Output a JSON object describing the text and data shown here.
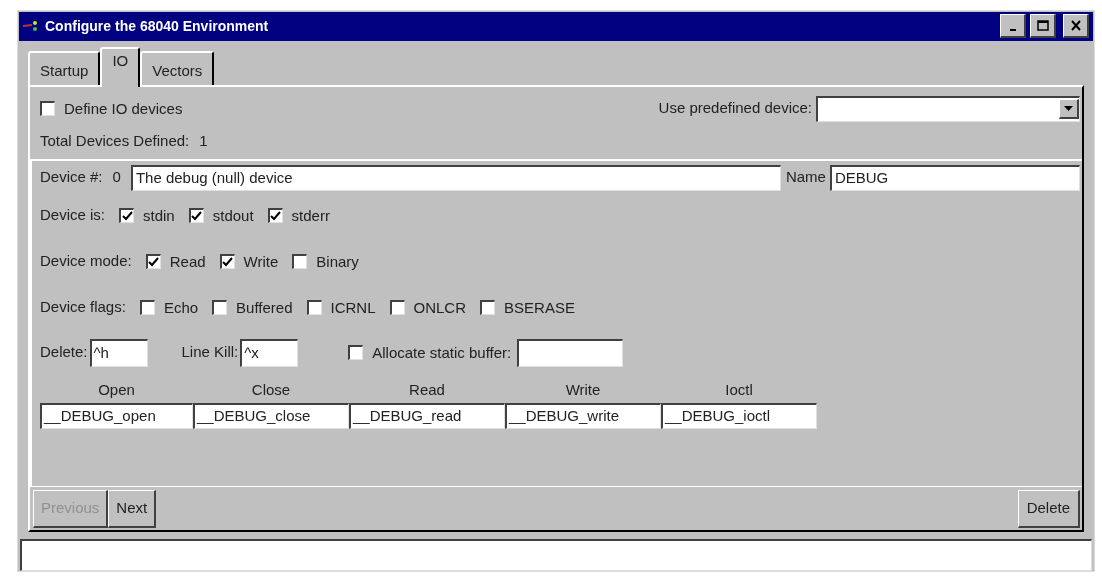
{
  "window": {
    "title": "Configure the 68040 Environment"
  },
  "tabs": [
    {
      "label": "Startup",
      "selected": false
    },
    {
      "label": "IO",
      "selected": true
    },
    {
      "label": "Vectors",
      "selected": false
    }
  ],
  "define_io": {
    "label": "Define IO devices",
    "checked": false
  },
  "predefined": {
    "label": "Use predefined device:"
  },
  "total": {
    "label": "Total Devices Defined:",
    "value": "1"
  },
  "device": {
    "number_label": "Device #:",
    "number": "0",
    "description": "The debug (null) device",
    "name_label": "Name",
    "name": "DEBUG"
  },
  "option_rows": [
    {
      "label": "Device is:",
      "options": [
        {
          "label": "stdin",
          "checked": true
        },
        {
          "label": "stdout",
          "checked": true
        },
        {
          "label": "stderr",
          "checked": true
        }
      ]
    },
    {
      "label": "Device mode:",
      "options": [
        {
          "label": "Read",
          "checked": true
        },
        {
          "label": "Write",
          "checked": true
        },
        {
          "label": "Binary",
          "checked": false
        }
      ]
    },
    {
      "label": "Device flags:",
      "options": [
        {
          "label": "Echo",
          "checked": false
        },
        {
          "label": "Buffered",
          "checked": false
        },
        {
          "label": "ICRNL",
          "checked": false
        },
        {
          "label": "ONLCR",
          "checked": false
        },
        {
          "label": "BSERASE",
          "checked": false
        }
      ]
    }
  ],
  "delete": {
    "label": "Delete:",
    "value": "^h"
  },
  "line_kill": {
    "label": "Line Kill:",
    "value": "^x"
  },
  "allocate": {
    "label": "Allocate static buffer:",
    "checked": false
  },
  "functions": [
    {
      "header": "Open",
      "value": "__DEBUG_open"
    },
    {
      "header": "Close",
      "value": "__DEBUG_close"
    },
    {
      "header": "Read",
      "value": "__DEBUG_read"
    },
    {
      "header": "Write",
      "value": "__DEBUG_write"
    },
    {
      "header": "Ioctl",
      "value": "__DEBUG_ioctl"
    }
  ],
  "buttons": [
    {
      "label": "Previous",
      "disabled": true
    },
    {
      "label": "Next",
      "disabled": false
    }
  ],
  "delete_button": {
    "label": "Delete"
  }
}
